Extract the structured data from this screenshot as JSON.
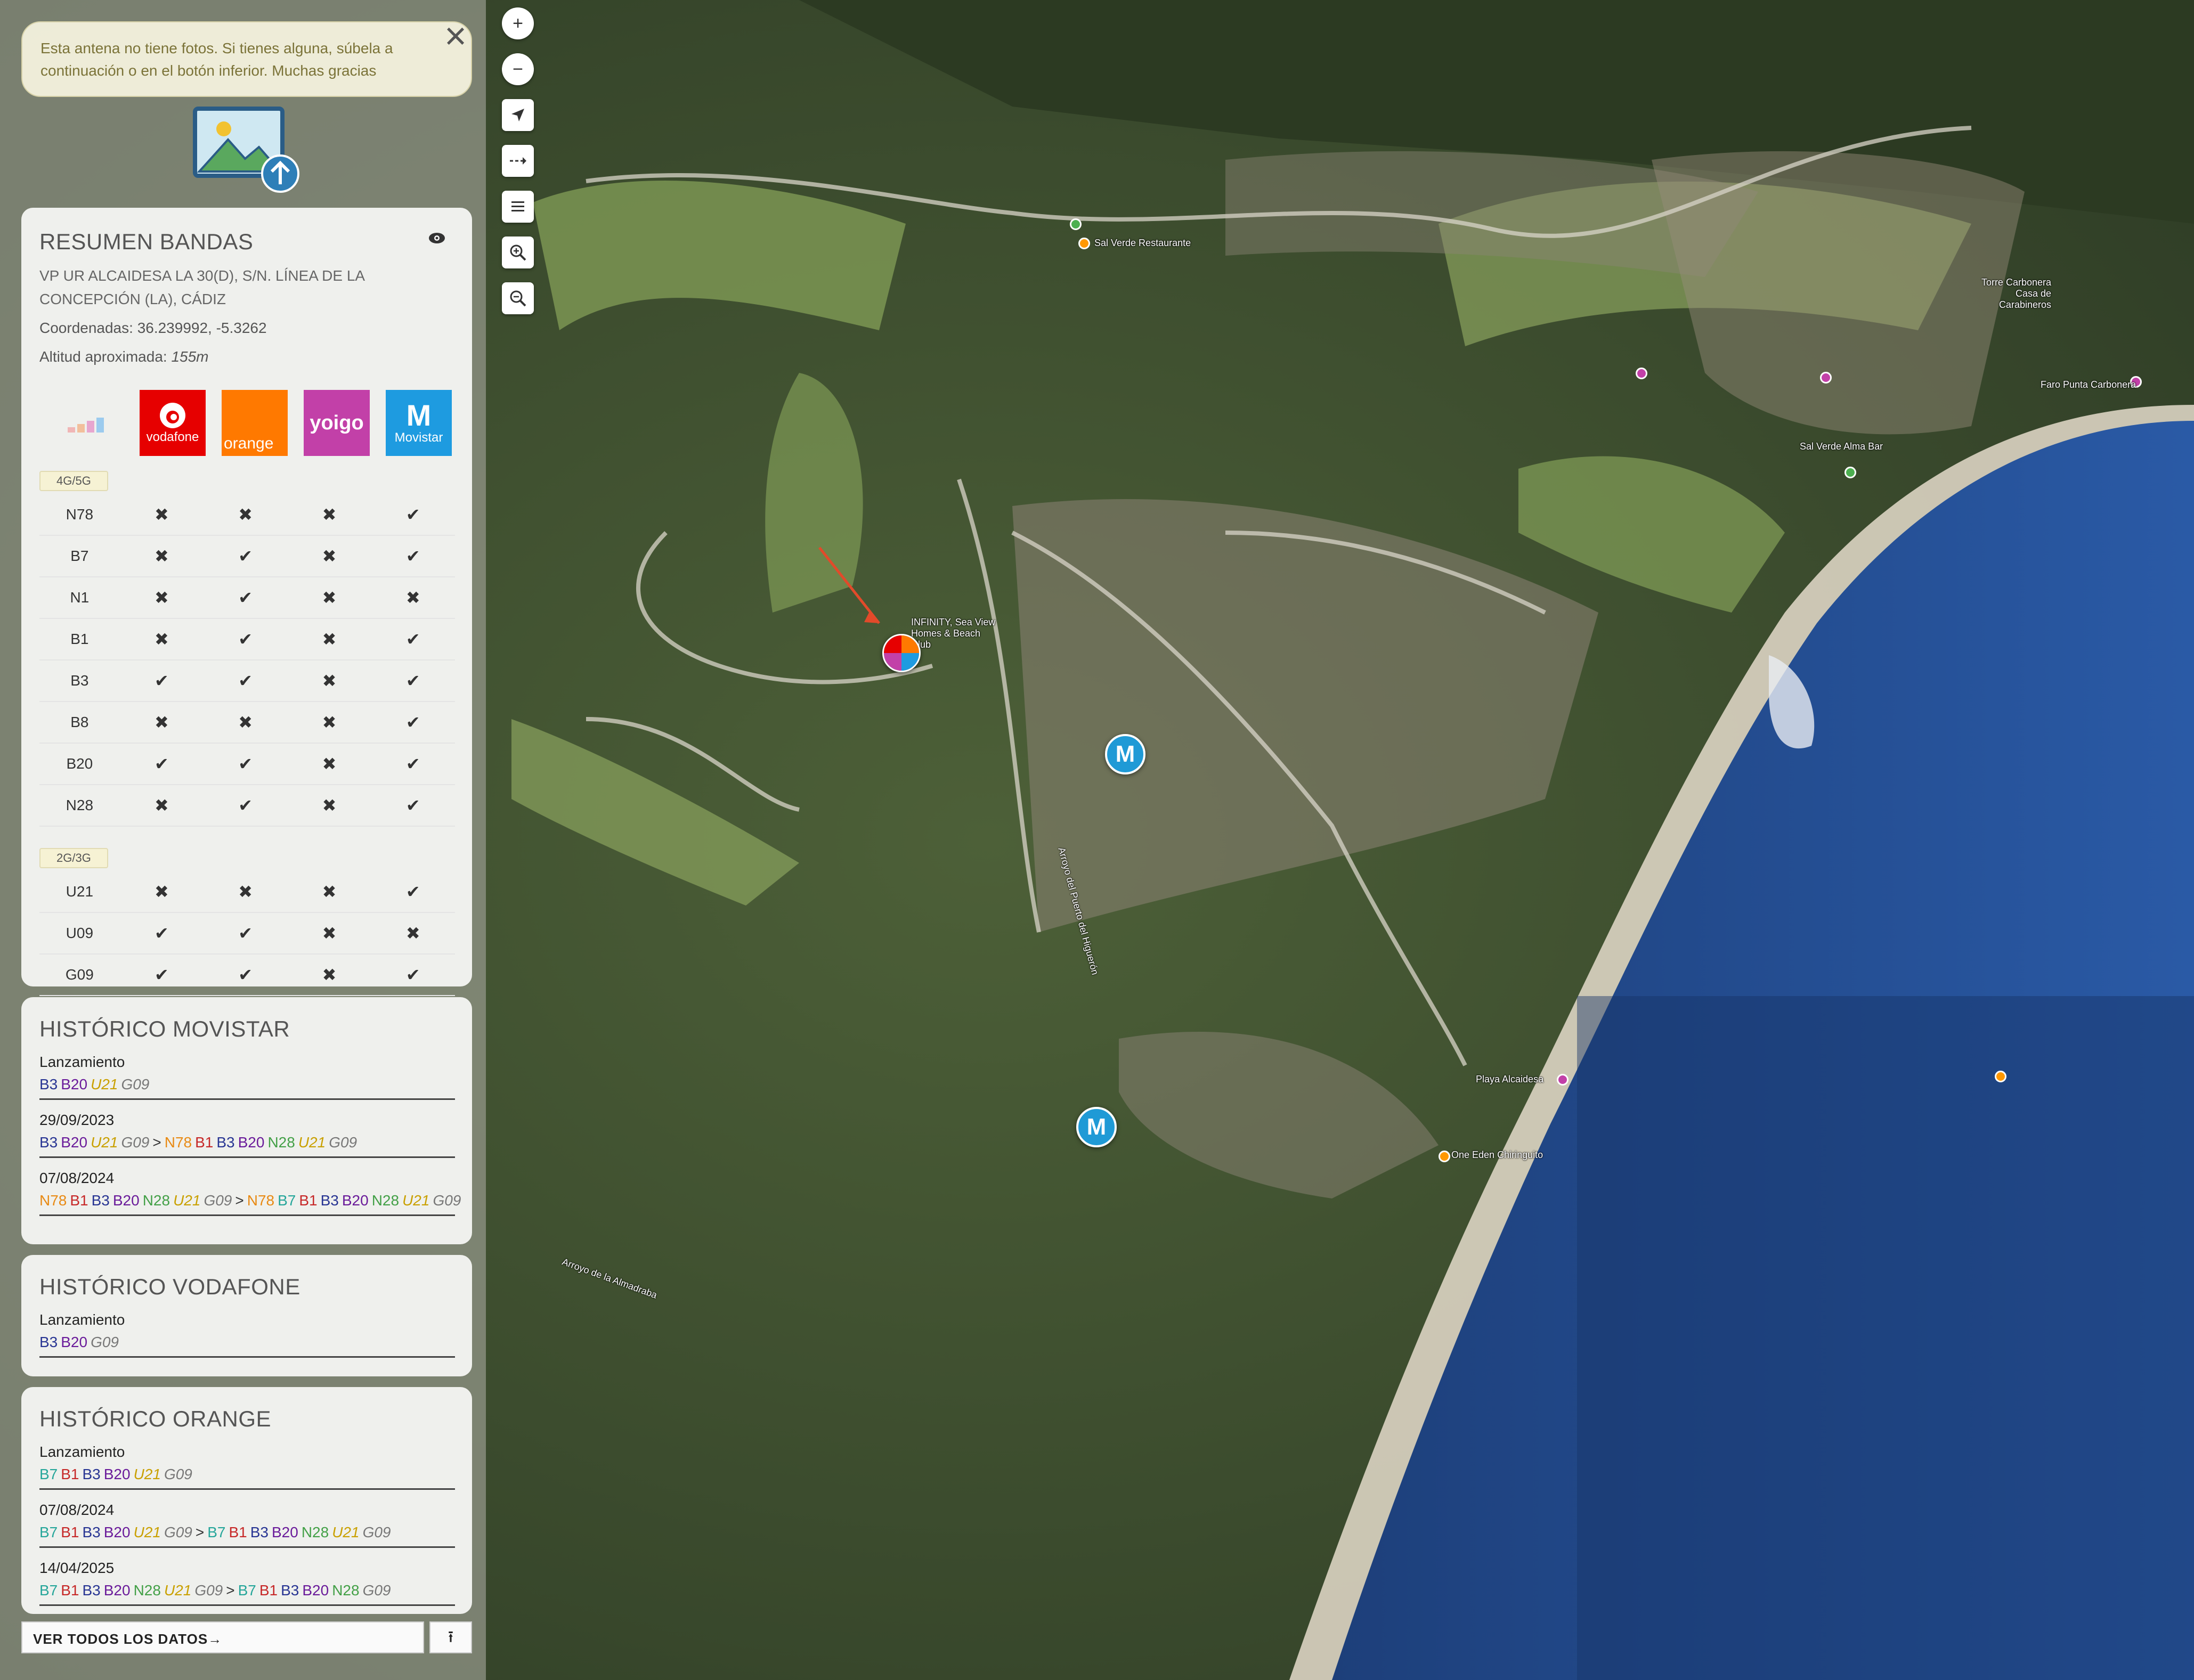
{
  "notice": {
    "text": "Esta antena no tiene fotos. Si tienes alguna, súbela a continuación o en el botón inferior. Muchas gracias",
    "close_icon": "×"
  },
  "summary": {
    "title": "RESUMEN BANDAS",
    "address": "VP UR ALCAIDESA LA 30(D), S/N. LÍNEA DE LA CONCEPCIÓN (LA), CÁDIZ",
    "coords_label": "Coordenadas:",
    "coords_value": "36.239992, -5.3262",
    "altitude_label": "Altitud aproximada:",
    "altitude_value": "155m",
    "operators": [
      {
        "name": "vodafone",
        "color": "#e60000"
      },
      {
        "name": "orange",
        "color": "#ff7900"
      },
      {
        "name": "yoigo",
        "color": "#c240a8"
      },
      {
        "name": "Movistar",
        "color": "#1e9be0"
      }
    ],
    "group_4g5g": "4G/5G",
    "group_2g3g": "2G/3G",
    "bands_4g5g": [
      {
        "band": "N78",
        "vals": [
          false,
          false,
          false,
          true
        ]
      },
      {
        "band": "B7",
        "vals": [
          false,
          true,
          false,
          true
        ]
      },
      {
        "band": "N1",
        "vals": [
          false,
          true,
          false,
          false
        ]
      },
      {
        "band": "B1",
        "vals": [
          false,
          true,
          false,
          true
        ]
      },
      {
        "band": "B3",
        "vals": [
          true,
          true,
          false,
          true
        ]
      },
      {
        "band": "B8",
        "vals": [
          false,
          false,
          false,
          true
        ]
      },
      {
        "band": "B20",
        "vals": [
          true,
          true,
          false,
          true
        ]
      },
      {
        "band": "N28",
        "vals": [
          false,
          true,
          false,
          true
        ]
      }
    ],
    "bands_2g3g": [
      {
        "band": "U21",
        "vals": [
          false,
          false,
          false,
          true
        ]
      },
      {
        "band": "U09",
        "vals": [
          true,
          true,
          false,
          false
        ]
      },
      {
        "band": "G09",
        "vals": [
          true,
          true,
          false,
          true
        ]
      }
    ]
  },
  "hist_movistar": {
    "title": "HISTÓRICO MOVISTAR",
    "entries": [
      {
        "date": "Lanzamiento",
        "before": [
          "B3",
          "B20",
          "U21",
          "G09"
        ],
        "after": []
      },
      {
        "date": "29/09/2023",
        "before": [
          "B3",
          "B20",
          "U21",
          "G09"
        ],
        "after": [
          "N78",
          "B1",
          "B3",
          "B20",
          "N28",
          "U21",
          "G09"
        ]
      },
      {
        "date": "07/08/2024",
        "before": [
          "N78",
          "B1",
          "B3",
          "B20",
          "N28",
          "U21",
          "G09"
        ],
        "after": [
          "N78",
          "B7",
          "B1",
          "B3",
          "B20",
          "N28",
          "U21",
          "G09"
        ]
      }
    ]
  },
  "hist_vodafone": {
    "title": "HISTÓRICO VODAFONE",
    "entries": [
      {
        "date": "Lanzamiento",
        "before": [
          "B3",
          "B20",
          "G09"
        ],
        "after": []
      }
    ]
  },
  "hist_orange": {
    "title": "HISTÓRICO ORANGE",
    "entries": [
      {
        "date": "Lanzamiento",
        "before": [
          "B7",
          "B1",
          "B3",
          "B20",
          "U21",
          "G09"
        ],
        "after": []
      },
      {
        "date": "07/08/2024",
        "before": [
          "B7",
          "B1",
          "B3",
          "B20",
          "U21",
          "G09"
        ],
        "after": [
          "B7",
          "B1",
          "B3",
          "B20",
          "N28",
          "U21",
          "G09"
        ]
      },
      {
        "date": "14/04/2025",
        "before": [
          "B7",
          "B1",
          "B3",
          "B20",
          "N28",
          "U21",
          "G09"
        ],
        "after": [
          "B7",
          "B1",
          "B3",
          "B20",
          "N28",
          "G09"
        ]
      }
    ]
  },
  "footer": {
    "view_all": "VER TODOS LOS DATOS→",
    "upload_icon": "upload-icon"
  },
  "map": {
    "labels": [
      {
        "text": "INFINITY, Sea View Homes & Beach Club"
      },
      {
        "text": "Sal Verde Restaurante"
      },
      {
        "text": "Playa Alcaidesa"
      },
      {
        "text": "Torre Carbonera Casa de Carabineros"
      },
      {
        "text": "Faro Punta Carbonera"
      },
      {
        "text": "Sal Verde Alma Bar"
      },
      {
        "text": "One Eden Chiringuito"
      },
      {
        "text": "Arroyo del Puerto del Higuerón"
      },
      {
        "text": "Arroyo de la Almadraba"
      }
    ]
  }
}
